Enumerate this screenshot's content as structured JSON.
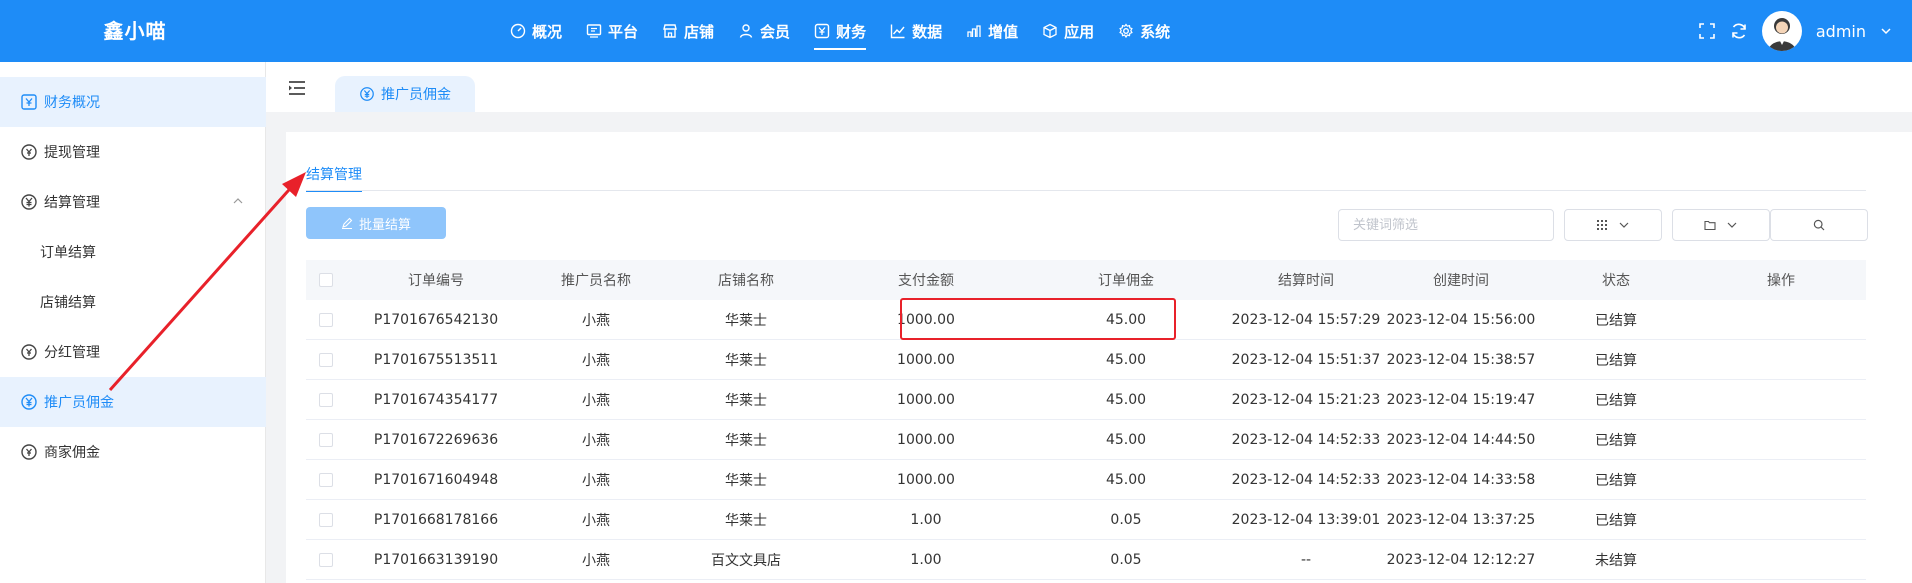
{
  "app": {
    "logo": "鑫小喵"
  },
  "nav": [
    {
      "label": "概况",
      "icon": "dashboard-icon"
    },
    {
      "label": "平台",
      "icon": "monitor-icon"
    },
    {
      "label": "店铺",
      "icon": "store-icon"
    },
    {
      "label": "会员",
      "icon": "user-icon"
    },
    {
      "label": "财务",
      "icon": "finance-icon",
      "active": true
    },
    {
      "label": "数据",
      "icon": "line-chart-icon"
    },
    {
      "label": "增值",
      "icon": "bar-growth-icon"
    },
    {
      "label": "应用",
      "icon": "cube-icon"
    },
    {
      "label": "系统",
      "icon": "gear-icon"
    }
  ],
  "user": {
    "name": "admin"
  },
  "sidebar": {
    "items": [
      {
        "label": "财务概况",
        "icon": "finance-icon"
      },
      {
        "label": "提现管理",
        "icon": "coin-icon"
      },
      {
        "label": "结算管理",
        "icon": "yen-icon"
      },
      {
        "label": "订单结算"
      },
      {
        "label": "店铺结算"
      },
      {
        "label": "分红管理",
        "icon": "coin-icon"
      },
      {
        "label": "推广员佣金",
        "icon": "yen-icon"
      },
      {
        "label": "商家佣金",
        "icon": "coin-icon"
      }
    ]
  },
  "tabs": {
    "active": "推广员佣金"
  },
  "subtab": {
    "label": "结算管理"
  },
  "toolbar": {
    "batch_label": "批量结算",
    "search_placeholder": "关键词筛选"
  },
  "table": {
    "headers": [
      "订单编号",
      "推广员名称",
      "店铺名称",
      "支付金额",
      "订单佣金",
      "结算时间",
      "创建时间",
      "状态",
      "操作"
    ],
    "rows": [
      [
        "P1701676542130",
        "小燕",
        "华莱士",
        "1000.00",
        "45.00",
        "2023-12-04 15:57:29",
        "2023-12-04 15:56:00",
        "已结算",
        ""
      ],
      [
        "P1701675513511",
        "小燕",
        "华莱士",
        "1000.00",
        "45.00",
        "2023-12-04 15:51:37",
        "2023-12-04 15:38:57",
        "已结算",
        ""
      ],
      [
        "P1701674354177",
        "小燕",
        "华莱士",
        "1000.00",
        "45.00",
        "2023-12-04 15:21:23",
        "2023-12-04 15:19:47",
        "已结算",
        ""
      ],
      [
        "P1701672269636",
        "小燕",
        "华莱士",
        "1000.00",
        "45.00",
        "2023-12-04 14:52:33",
        "2023-12-04 14:44:50",
        "已结算",
        ""
      ],
      [
        "P1701671604948",
        "小燕",
        "华莱士",
        "1000.00",
        "45.00",
        "2023-12-04 14:52:33",
        "2023-12-04 14:33:58",
        "已结算",
        ""
      ],
      [
        "P1701668178166",
        "小燕",
        "华莱士",
        "1.00",
        "0.05",
        "2023-12-04 13:39:01",
        "2023-12-04 13:37:25",
        "已结算",
        ""
      ],
      [
        "P1701663139190",
        "小燕",
        "百文文具店",
        "1.00",
        "0.05",
        "--",
        "2023-12-04 12:12:27",
        "未结算",
        ""
      ]
    ]
  },
  "colors": {
    "primary": "#1e8cf7",
    "annotation": "#e8212a"
  }
}
